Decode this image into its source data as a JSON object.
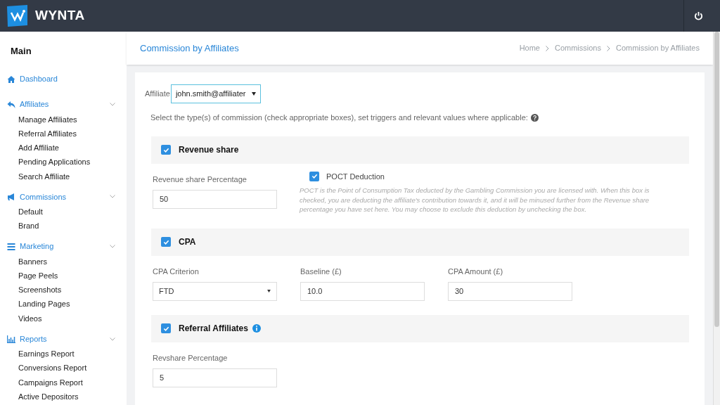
{
  "topbar": {
    "brand": "WYNTA"
  },
  "sidebar": {
    "title": "Main",
    "groups": [
      {
        "label": "Dashboard"
      },
      {
        "label": "Affiliates",
        "items": [
          "Manage Affiliates",
          "Referral Affiliates",
          "Add Affiliate",
          "Pending Applications",
          "Search Affiliate"
        ]
      },
      {
        "label": "Commissions",
        "items": [
          "Default",
          "Brand"
        ]
      },
      {
        "label": "Marketing",
        "items": [
          "Banners",
          "Page Peels",
          "Screenshots",
          "Landing Pages",
          "Videos"
        ]
      },
      {
        "label": "Reports",
        "items": [
          "Earnings Report",
          "Conversions Report",
          "Campaigns Report",
          "Active Depositors"
        ]
      }
    ]
  },
  "page_title": "Commission by Affiliates",
  "breadcrumb": [
    "Home",
    "Commissions",
    "Commission by Affiliates"
  ],
  "affiliate": {
    "label": "Affiliate",
    "value": "john.smith@affiliater"
  },
  "instructions": "Select the type(s) of commission (check appropriate boxes), set triggers and relevant values where applicable:",
  "sections": [
    {
      "title": "Revenue share",
      "checked": true,
      "fields": [
        {
          "kind": "input",
          "label": "Revenue share Percentage",
          "value": "50"
        }
      ],
      "option": {
        "label": "POCT Deduction",
        "checked": true,
        "note": "POCT is the Point of Consumption Tax deducted by the Gambling Commission you are licensed with. When this box is checked, you are deducting the affiliate's contribution towards it, and it will be minused further from the Revenue share percentage you have set here. You may choose to exclude this deduction by unchecking the box."
      }
    },
    {
      "title": "CPA",
      "checked": true,
      "fields": [
        {
          "kind": "select",
          "label": "CPA Criterion",
          "value": "FTD"
        },
        {
          "kind": "input",
          "label": "Baseline (£)",
          "value": "10.0"
        },
        {
          "kind": "input",
          "label": "CPA Amount (£)",
          "value": "30"
        }
      ]
    },
    {
      "title": "Referral Affiliates",
      "checked": true,
      "info": true,
      "fields": [
        {
          "kind": "input",
          "label": "Revshare Percentage",
          "value": "5"
        }
      ]
    }
  ]
}
